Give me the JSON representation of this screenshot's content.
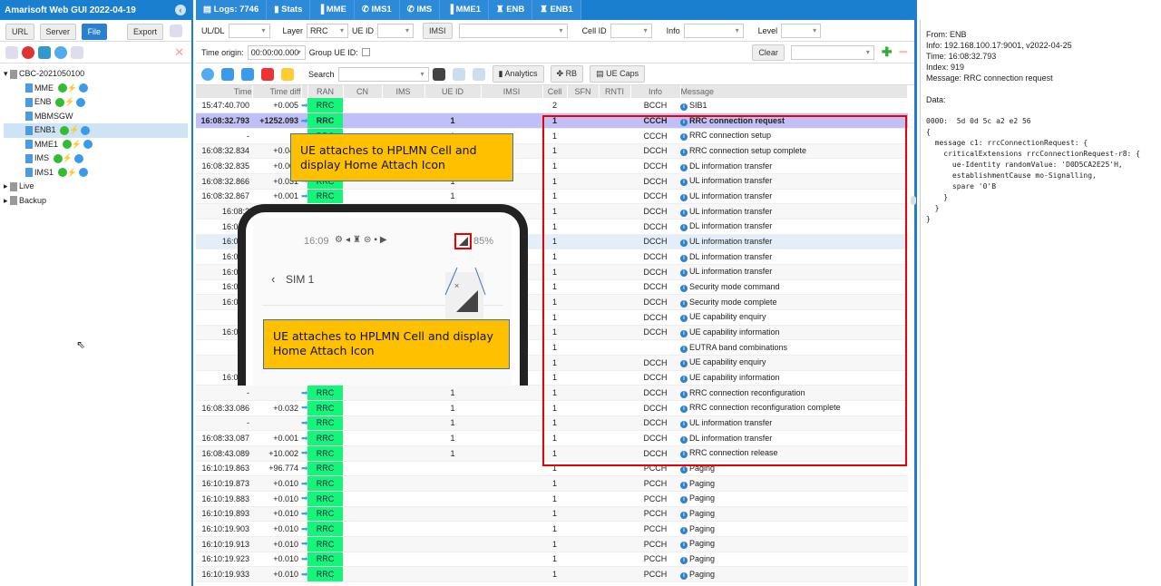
{
  "app": {
    "title": "Amarisoft Web GUI 2022-04-19"
  },
  "left": {
    "buttons": [
      "URL",
      "Server",
      "File",
      "Export"
    ],
    "tree": {
      "root": "CBC-2021050100",
      "children": [
        "MME",
        "ENB",
        "MBMSGW",
        "ENB1",
        "MME1",
        "IMS",
        "IMS1"
      ],
      "selected": "ENB1",
      "other": [
        "Live",
        "Backup"
      ]
    }
  },
  "tabs": [
    "Logs: 7746",
    "Stats",
    "MME",
    "IMS1",
    "IMS",
    "MME1",
    "ENB",
    "ENB1"
  ],
  "filters": {
    "uldl": "UL/DL",
    "layer_label": "Layer",
    "layer_value": "RRC",
    "ueid": "UE ID",
    "imsi": "IMSI",
    "cellid": "Cell ID",
    "info": "Info",
    "level": "Level",
    "time_origin_label": "Time origin:",
    "time_origin": "00:00:00.000",
    "group_ue": "Group UE ID:",
    "clear": "Clear",
    "search": "Search",
    "analytics": "Analytics",
    "rb": "RB",
    "uecaps": "UE Caps"
  },
  "columns": [
    "Time",
    "Time diff",
    "RAN",
    "CN",
    "IMS",
    "UE ID",
    "IMSI",
    "Cell",
    "SFN",
    "RNTI",
    "Info",
    "Message"
  ],
  "rows": [
    [
      "15:47:40.700",
      "+0.005",
      "RRC",
      "",
      "2",
      "BCCH",
      "SIB1"
    ],
    [
      "16:08:32.793",
      "+1252.093",
      "RRC",
      "1",
      "1",
      "CCCH",
      "RRC connection request"
    ],
    [
      "-",
      "",
      "RRC",
      "1",
      "1",
      "CCCH",
      "RRC connection setup"
    ],
    [
      "16:08:32.834",
      "+0.041",
      "RRC",
      "1",
      "1",
      "DCCH",
      "RRC connection setup complete"
    ],
    [
      "16:08:32.835",
      "+0.001",
      "RRC",
      "1",
      "1",
      "DCCH",
      "DL information transfer"
    ],
    [
      "16:08:32.866",
      "+0.031",
      "RRC",
      "1",
      "1",
      "DCCH",
      "UL information transfer"
    ],
    [
      "16:08:32.867",
      "+0.001",
      "RRC",
      "1",
      "1",
      "DCCH",
      "UL information transfer"
    ],
    [
      "16:08:3",
      "",
      "RRC",
      "1",
      "1",
      "DCCH",
      "UL information transfer"
    ],
    [
      "16:08:3",
      "",
      "RRC",
      "1",
      "1",
      "DCCH",
      "DL information transfer"
    ],
    [
      "16:08:3",
      "",
      "RRC",
      "1",
      "1",
      "DCCH",
      "UL information transfer"
    ],
    [
      "16:08:3",
      "",
      "RRC",
      "1",
      "1",
      "DCCH",
      "DL information transfer"
    ],
    [
      "16:08:3",
      "",
      "RRC",
      "1",
      "1",
      "DCCH",
      "UL information transfer"
    ],
    [
      "16:08:3",
      "",
      "RRC",
      "1",
      "1",
      "DCCH",
      "Security mode command"
    ],
    [
      "16:08:3",
      "",
      "RRC",
      "1",
      "1",
      "DCCH",
      "Security mode complete"
    ],
    [
      "",
      "",
      "RRC",
      "1",
      "1",
      "DCCH",
      "UE capability enquiry"
    ],
    [
      "16:08:3",
      "",
      "RRC",
      "1",
      "1",
      "DCCH",
      "UE capability information"
    ],
    [
      "",
      "",
      "RRC",
      "1",
      "1",
      "",
      "EUTRA band combinations"
    ],
    [
      "",
      "",
      "RRC",
      "1",
      "1",
      "DCCH",
      "UE capability enquiry"
    ],
    [
      "16:08:3",
      "",
      "RRC",
      "1",
      "1",
      "DCCH",
      "UE capability information"
    ],
    [
      "-",
      "",
      "RRC",
      "1",
      "1",
      "DCCH",
      "RRC connection reconfiguration"
    ],
    [
      "16:08:33.086",
      "+0.032",
      "RRC",
      "1",
      "1",
      "DCCH",
      "RRC connection reconfiguration complete"
    ],
    [
      "-",
      "",
      "RRC",
      "1",
      "1",
      "DCCH",
      "UL information transfer"
    ],
    [
      "16:08:33.087",
      "+0.001",
      "RRC",
      "1",
      "1",
      "DCCH",
      "DL information transfer"
    ],
    [
      "16:08:43.089",
      "+10.002",
      "RRC",
      "1",
      "1",
      "DCCH",
      "RRC connection release"
    ],
    [
      "16:10:19.863",
      "+96.774",
      "RRC",
      "",
      "1",
      "PCCH",
      "Paging"
    ],
    [
      "16:10:19.873",
      "+0.010",
      "RRC",
      "",
      "1",
      "PCCH",
      "Paging"
    ],
    [
      "16:10:19.883",
      "+0.010",
      "RRC",
      "",
      "1",
      "PCCH",
      "Paging"
    ],
    [
      "16:10:19.893",
      "+0.010",
      "RRC",
      "",
      "1",
      "PCCH",
      "Paging"
    ],
    [
      "16:10:19.903",
      "+0.010",
      "RRC",
      "",
      "1",
      "PCCH",
      "Paging"
    ],
    [
      "16:10:19.913",
      "+0.010",
      "RRC",
      "",
      "1",
      "PCCH",
      "Paging"
    ],
    [
      "16:10:19.923",
      "+0.010",
      "RRC",
      "",
      "1",
      "PCCH",
      "Paging"
    ],
    [
      "16:10:19.933",
      "+0.010",
      "RRC",
      "",
      "1",
      "PCCH",
      "Paging"
    ]
  ],
  "detail": {
    "from": "From: ENB",
    "info": "Info: 192.168.100.17:9001, v2022-04-25",
    "time": "Time: 16:08:32.793",
    "index": "Index: 919",
    "message": "Message: RRC connection request",
    "data_label": "Data:",
    "code": "0000:  5d 0d 5c a2 e2 56\n{\n  message c1: rrcConnectionRequest: {\n    criticalExtensions rrcConnectionRequest-r8: {\n      ue-Identity randomValue: 'D0D5CA2E25'H,\n      establishmentCause mo-Signalling,\n      spare '0'B\n    }\n  }\n}"
  },
  "overlay": {
    "callout1": "UE attaches to HPLMN Cell and display Home Attach Icon",
    "callout2": "UE attaches to HPLMN Cell and display Home Attach Icon",
    "phone_time": "16:09",
    "phone_battery": "85%",
    "phone_title": "SIM 1"
  },
  "colors": {
    "accent": "#1b7fd0",
    "ran": "#14f57a",
    "selected_row": "#c0c0f6",
    "highlight_box": "#e00000",
    "callout": "#ffc000"
  }
}
